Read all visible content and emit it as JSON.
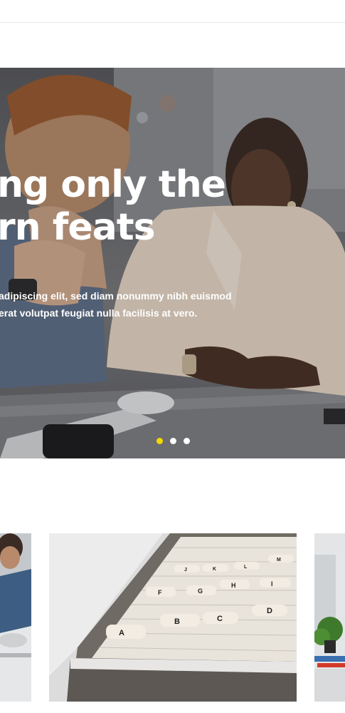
{
  "hero": {
    "headline_line1": "ng only the",
    "headline_line2": "rn feats",
    "subtext_line1": "adipiscing elit, sed diam nonummy nibh euismod",
    "subtext_line2": "erat volutpat feugiat nulla facilisis at vero.",
    "slider": {
      "total_slides": 3,
      "active_slide": 1
    },
    "colors": {
      "active_dot": "#f5d800",
      "inactive_dot": "#ffffff",
      "text": "#ffffff"
    }
  },
  "cards": {
    "file_tabs": [
      "A",
      "B",
      "C",
      "D",
      "F",
      "G",
      "H",
      "I",
      "J",
      "K",
      "L",
      "M"
    ]
  }
}
